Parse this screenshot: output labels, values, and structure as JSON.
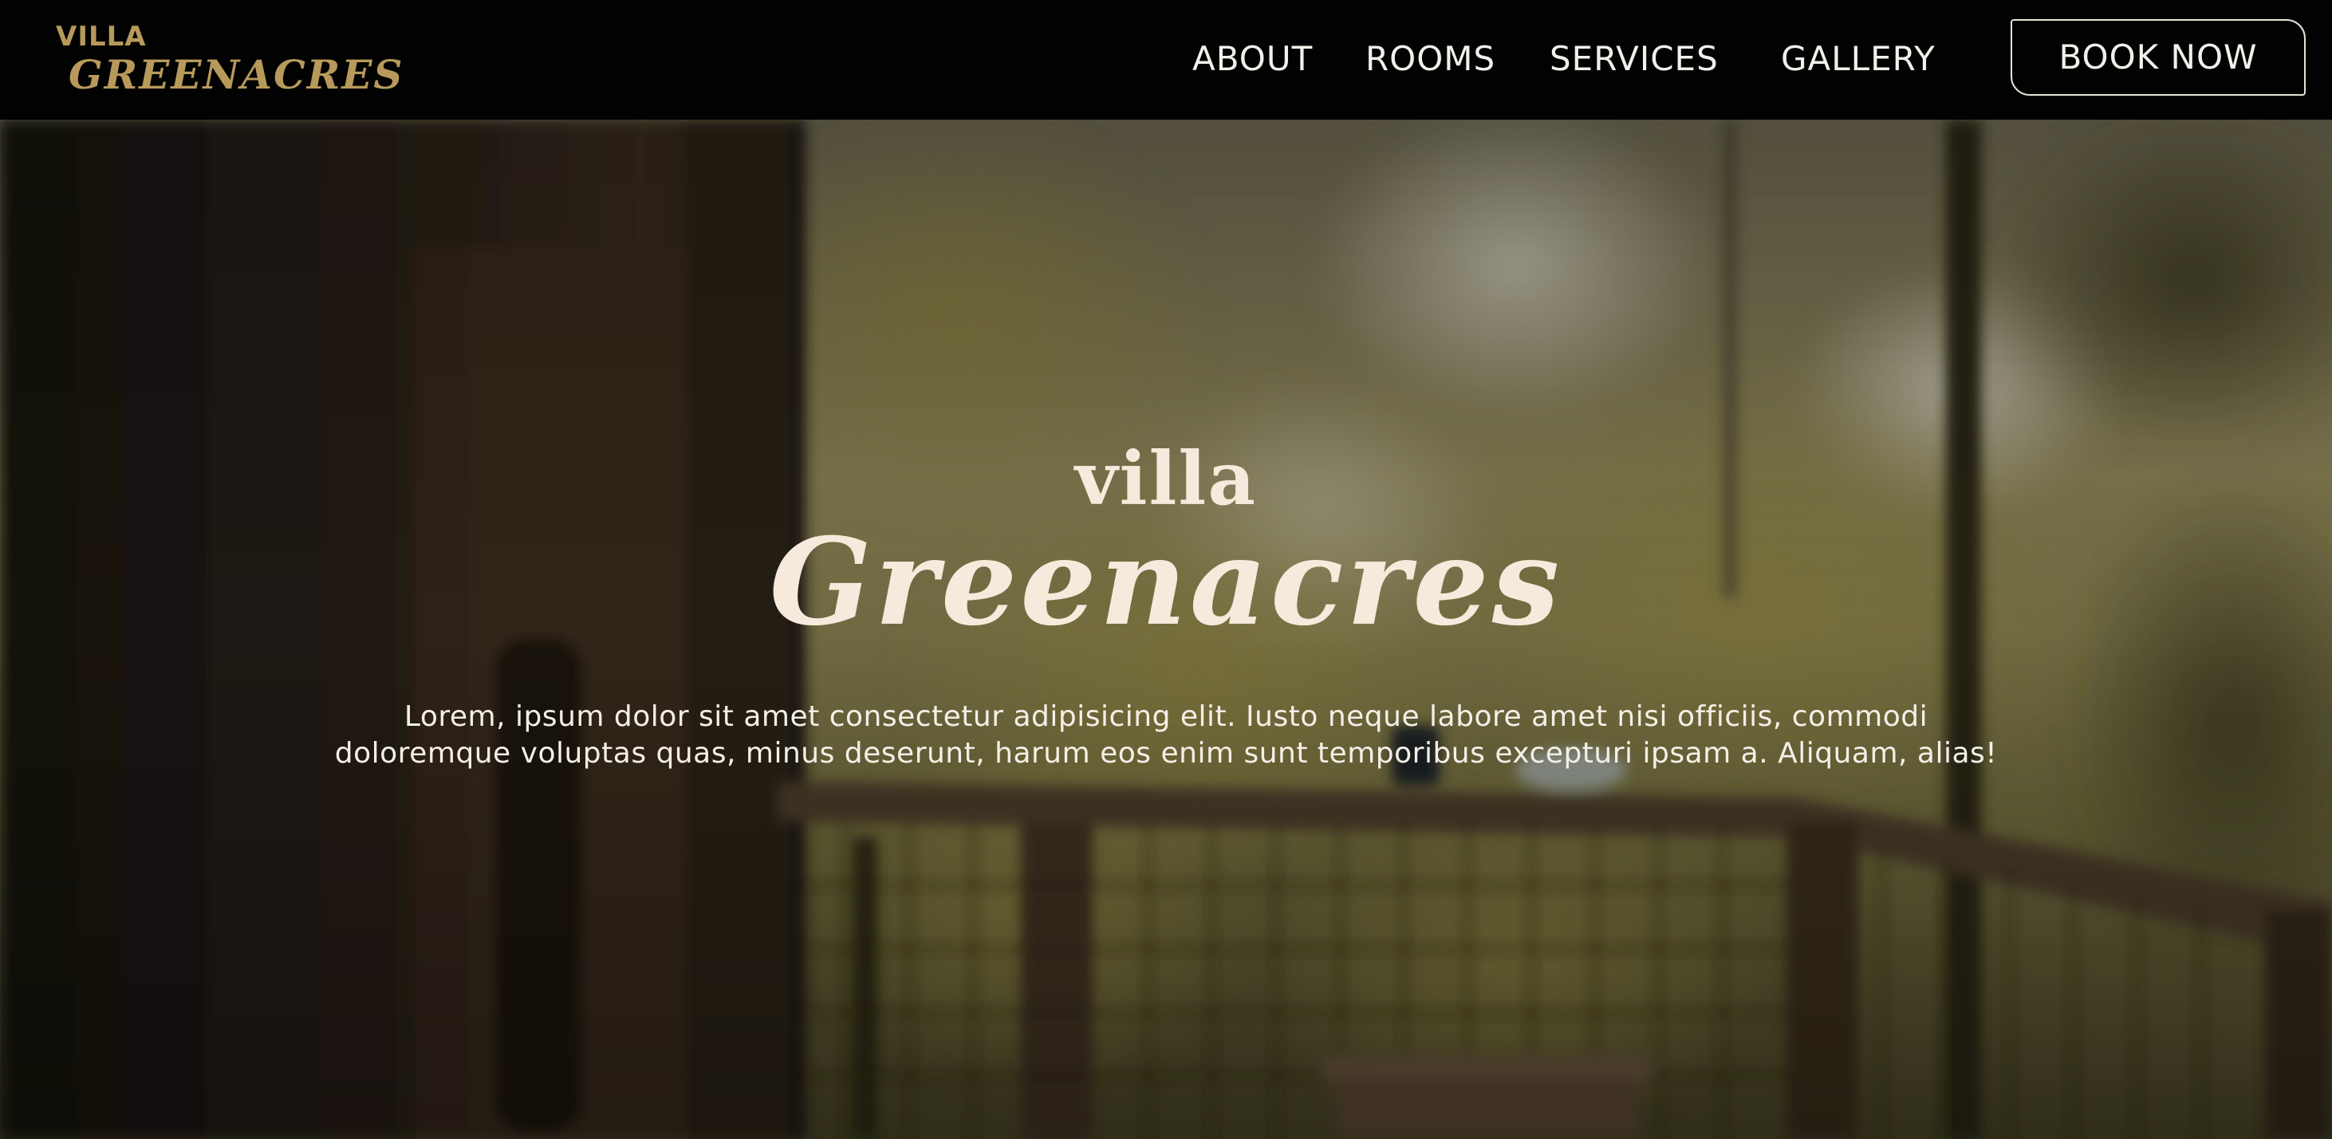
{
  "header": {
    "logo": {
      "small": "VILLA",
      "big": "GREENACRES"
    },
    "nav": [
      {
        "label": "ABOUT"
      },
      {
        "label": "ROOMS"
      },
      {
        "label": "SERVICES"
      },
      {
        "label": "GALLERY"
      }
    ],
    "cta_label": "BOOK NOW"
  },
  "hero": {
    "title_small": "villa",
    "title_big": "Greenacres",
    "description": "Lorem, ipsum dolor sit amet consectetur adipisicing elit. Iusto neque labore amet nisi officiis, commodi doloremque voluptas quas, minus deserunt, harum eos enim sunt temporibus excepturi ipsam a. Aliquam, alias!"
  },
  "colors": {
    "header_bg": "#020202",
    "logo_gold": "#b79a5b",
    "hero_title": "#f6eadc",
    "nav_text": "#f3f0ea"
  }
}
